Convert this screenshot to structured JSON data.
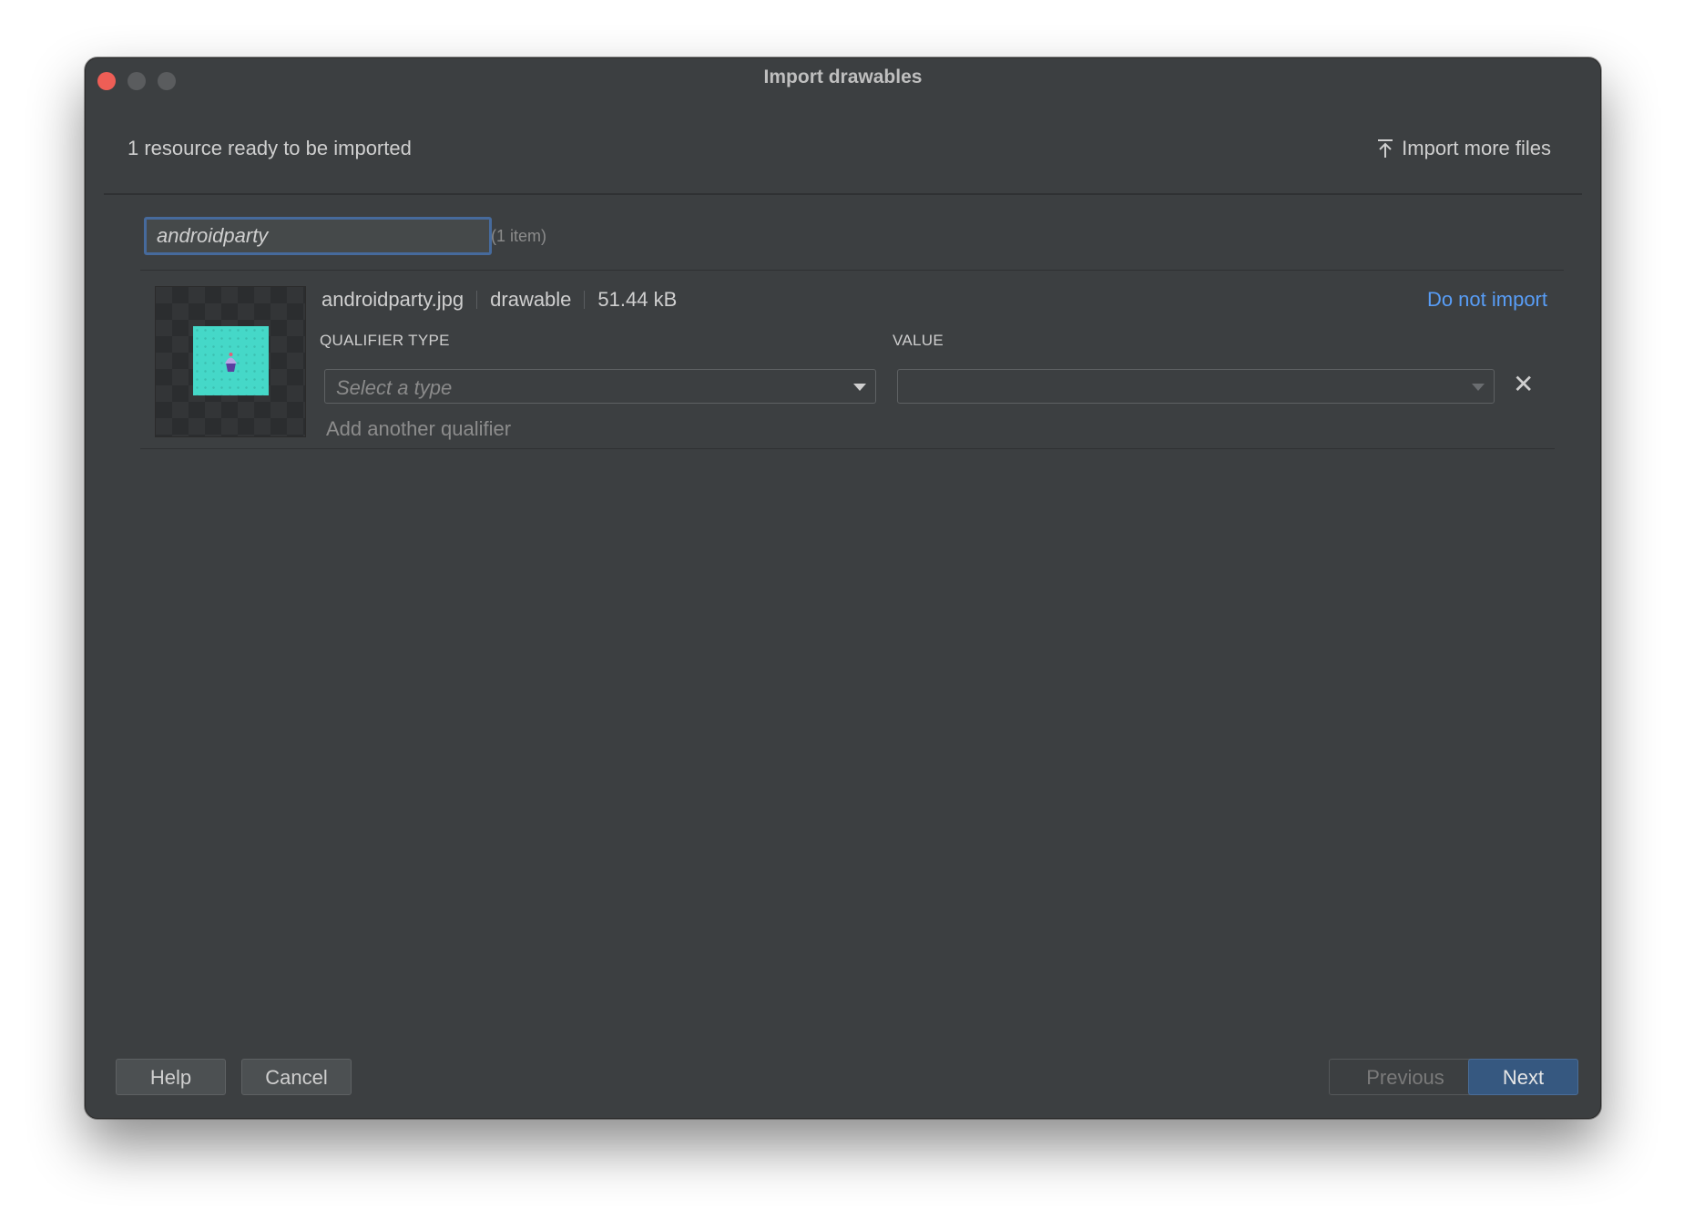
{
  "window": {
    "title": "Import drawables"
  },
  "header": {
    "status": "1 resource ready to be imported",
    "import_more_label": "Import more files"
  },
  "search": {
    "value": "androidparty",
    "count": "(1 item)"
  },
  "resource": {
    "filename": "androidparty.jpg",
    "type": "drawable",
    "size": "51.44 kB",
    "remove_label": "Do not import",
    "qualifier_type_header": "QUALIFIER TYPE",
    "value_header": "VALUE",
    "qualifier_placeholder": "Select a type",
    "value_current": "",
    "add_qualifier_label": "Add another qualifier"
  },
  "footer": {
    "help": "Help",
    "cancel": "Cancel",
    "previous": "Previous",
    "next": "Next"
  },
  "colors": {
    "accent": "#589df6",
    "primary_button": "#365880",
    "focus_border": "#466a9c"
  }
}
